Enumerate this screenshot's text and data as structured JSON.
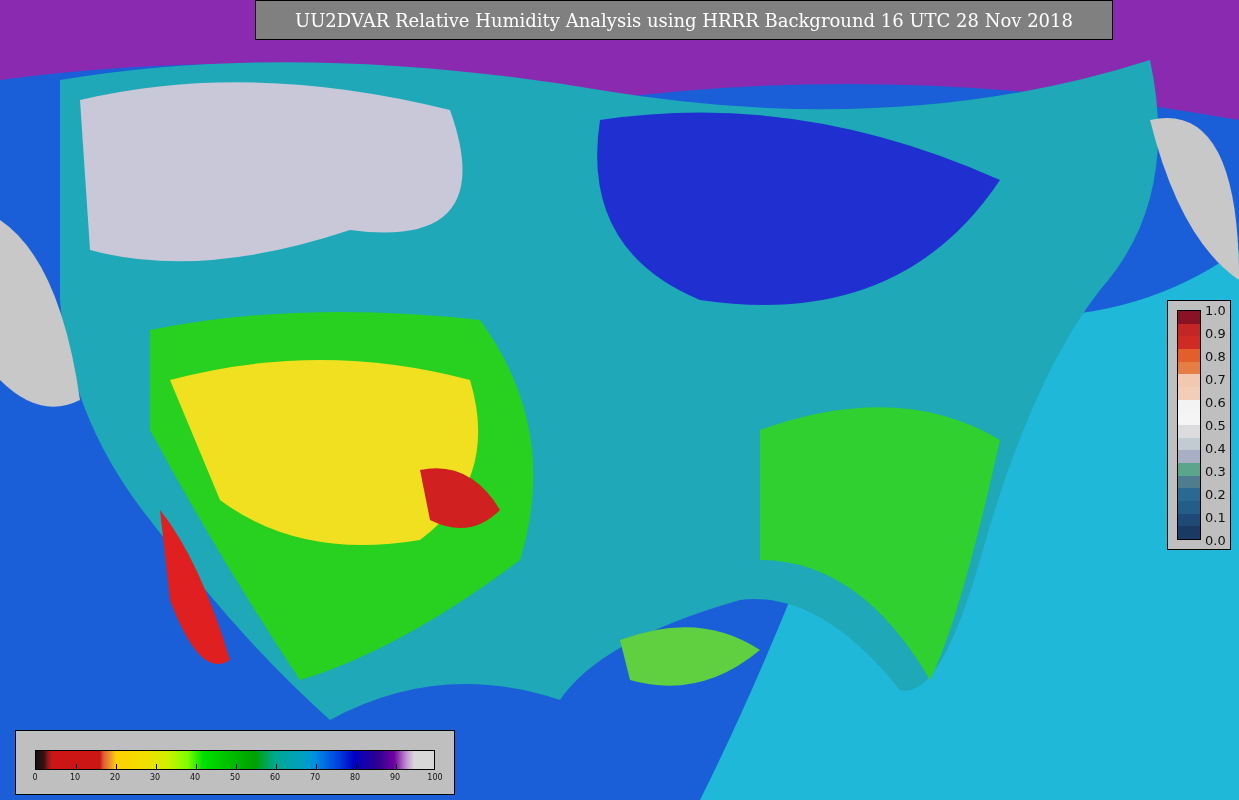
{
  "title": "UU2DVAR Relative Humidity Analysis using HRRR Background 16 UTC 28 Nov 2018",
  "humidity_colorbar": {
    "ticks": [
      "0",
      "10",
      "20",
      "30",
      "40",
      "50",
      "60",
      "70",
      "80",
      "90",
      "100"
    ]
  },
  "ratio_colorbar": {
    "ticks": [
      "1.0",
      "0.9",
      "0.8",
      "0.7",
      "0.6",
      "0.5",
      "0.4",
      "0.3",
      "0.2",
      "0.1",
      "0.0"
    ]
  }
}
